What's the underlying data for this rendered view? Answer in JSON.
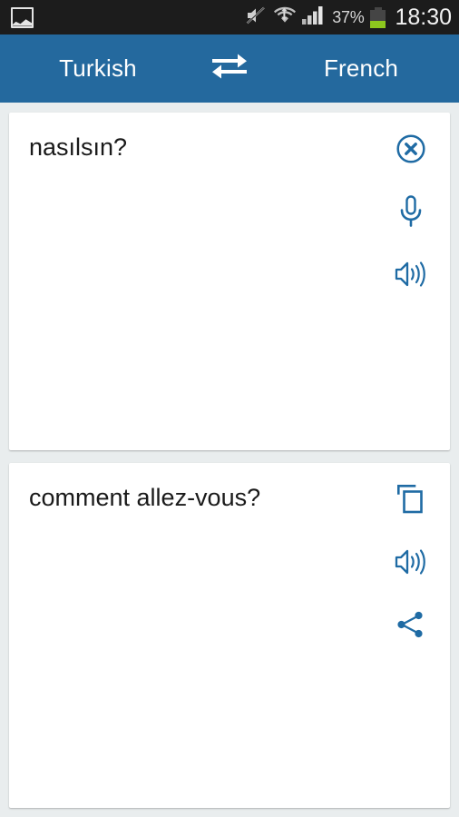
{
  "statusbar": {
    "notification_icon": "image-icon",
    "mute_icon": "volume-mute-icon",
    "wifi_icon": "wifi-transfer-icon",
    "signal_icon": "cellular-signal-icon",
    "battery_percent": "37%",
    "battery_icon": "battery-icon",
    "time": "18:30",
    "battery_level": 37,
    "colors": {
      "background": "#1c1c1c",
      "text": "#e8e8e8",
      "battery_fill": "#8dc71e"
    }
  },
  "header": {
    "source_language": "Turkish",
    "swap_icon": "swap-arrows-icon",
    "target_language": "French",
    "color": "#24699e"
  },
  "cards": {
    "source": {
      "text": "nasılsın?",
      "actions": [
        {
          "name": "clear-button",
          "icon": "close-circle-icon"
        },
        {
          "name": "voice-input-button",
          "icon": "microphone-icon"
        },
        {
          "name": "speak-source-button",
          "icon": "speaker-icon"
        }
      ]
    },
    "target": {
      "text": "comment allez-vous?",
      "actions": [
        {
          "name": "copy-button",
          "icon": "copy-icon"
        },
        {
          "name": "speak-target-button",
          "icon": "speaker-icon"
        },
        {
          "name": "share-button",
          "icon": "share-icon"
        }
      ]
    },
    "icon_color": "#1f6ba4",
    "background": "#ffffff",
    "page_background": "#e9edee"
  }
}
